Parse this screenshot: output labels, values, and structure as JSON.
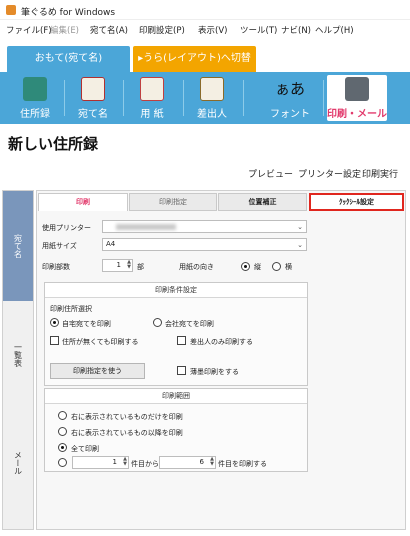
{
  "window": {
    "title": "筆ぐるめ for Windows"
  },
  "menu": [
    "ファイル(F)",
    "編集(E)",
    "宛て名(A)",
    "印刷設定(P)",
    "表示(V)",
    "ツール(T)",
    "ナビ(N)",
    "ヘルプ(H)"
  ],
  "tabs": {
    "front": "おもて(宛て名)",
    "back": "▸うら(レイアウト)へ切替"
  },
  "toolbar": [
    "住所録",
    "宛て名",
    "用 紙",
    "差出人",
    "フォント",
    "印刷・メール"
  ],
  "font_glyph": "ぁあ",
  "page_title": "新しい住所録",
  "actions": {
    "preview": "プレビュー",
    "printer_setup": "プリンター設定",
    "print_execute": "印刷実行"
  },
  "side_tabs": [
    "宛て名",
    "一覧表",
    "メール"
  ],
  "subtabs": [
    "印刷",
    "印刷指定",
    "位置補正",
    "ｸｯｸｼｰﾙ設定"
  ],
  "form": {
    "printer_label": "使用プリンター",
    "paper_label": "用紙サイズ",
    "paper_value": "A4",
    "copies_label": "印刷部数",
    "copies_value": "1",
    "copies_unit": "部",
    "orientation_label": "用紙の向き",
    "orientation_options": [
      "縦",
      "横"
    ]
  },
  "condition": {
    "header": "印刷条件設定",
    "address_select_label": "印刷住所選択",
    "home_option": "自宅宛てを印刷",
    "company_option": "会社宛てを印刷",
    "no_address_check": "住所が無くても印刷する",
    "sender_only_check": "差出人のみ印刷する",
    "use_print_spec_button": "印刷指定を使う",
    "thin_print_check": "薄墨印刷をする"
  },
  "range": {
    "header": "印刷範囲",
    "option1": "右に表示されているものだけを印刷",
    "option2": "右に表示されているもの以降を印刷",
    "option3": "全て印刷",
    "from_value": "1",
    "from_label": "件目から",
    "to_value": "6",
    "to_label": "件目を印刷する"
  }
}
